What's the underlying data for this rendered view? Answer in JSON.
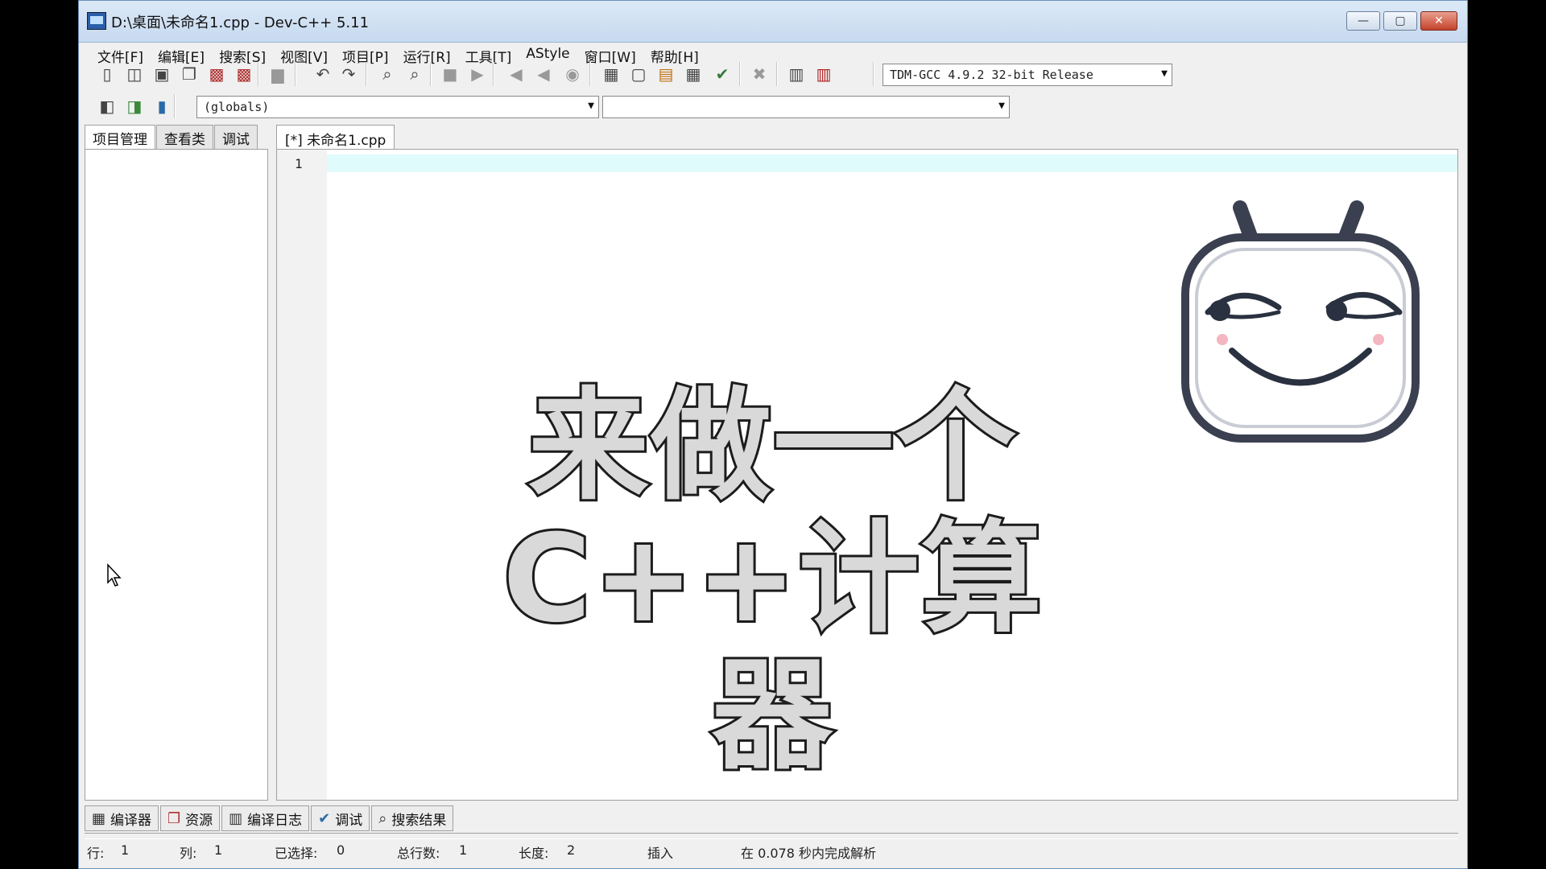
{
  "window": {
    "title": "D:\\桌面\\未命名1.cpp - Dev-C++ 5.11",
    "min_glyph": "—",
    "max_glyph": "▢",
    "close_glyph": "✕"
  },
  "menu": [
    "文件[F]",
    "编辑[E]",
    "搜索[S]",
    "视图[V]",
    "项目[P]",
    "运行[R]",
    "工具[T]",
    "AStyle",
    "窗口[W]",
    "帮助[H]"
  ],
  "toolbar": {
    "compiler_select": "TDM-GCC 4.9.2 32-bit Release",
    "scope_select": "(globals)",
    "member_select": ""
  },
  "left_panel": {
    "tabs": [
      "项目管理",
      "查看类",
      "调试"
    ]
  },
  "editor": {
    "file_tab": "[*] 未命名1.cpp",
    "line_number": "1"
  },
  "overlay": {
    "line1": "来做一个",
    "line2": "C++计算器"
  },
  "bottom_tabs": [
    {
      "icon": "grid-icon",
      "glyph": "▦",
      "label": "编译器"
    },
    {
      "icon": "resources-icon",
      "glyph": "❐",
      "label": "资源"
    },
    {
      "icon": "chart-icon",
      "glyph": "▥",
      "label": "编译日志"
    },
    {
      "icon": "check-icon",
      "glyph": "✔",
      "label": "调试"
    },
    {
      "icon": "search-icon",
      "glyph": "⌕",
      "label": "搜索结果"
    }
  ],
  "status": {
    "row_label": "行:",
    "row_value": "1",
    "col_label": "列:",
    "col_value": "1",
    "sel_label": "已选择:",
    "sel_value": "0",
    "lines_label": "总行数:",
    "lines_value": "1",
    "len_label": "长度:",
    "len_value": "2",
    "mode": "插入",
    "parse_info": "在 0.078 秒内完成解析"
  },
  "colors": {
    "current_line": "#e0fbfb",
    "title_gradient_top": "#dce9f7",
    "close_button": "#c4412a",
    "mascot_outline": "#3a4050"
  }
}
